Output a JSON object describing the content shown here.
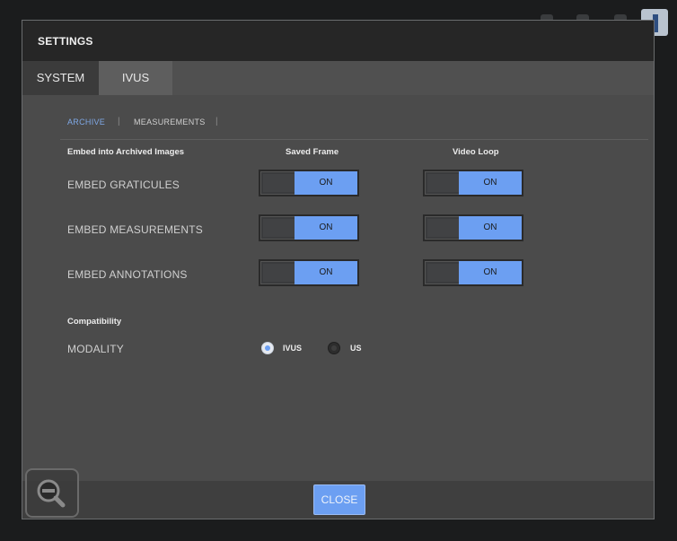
{
  "dialog": {
    "title": "SETTINGS"
  },
  "tabs": [
    {
      "label": "SYSTEM",
      "active": true
    },
    {
      "label": "IVUS",
      "active": false
    }
  ],
  "subtabs": [
    {
      "label": "ARCHIVE",
      "active": true
    },
    {
      "label": "MEASUREMENTS",
      "active": false
    }
  ],
  "archive": {
    "section_title": "Embed into Archived Images",
    "columns": [
      "Saved Frame",
      "Video Loop"
    ],
    "rows": [
      {
        "label": "EMBED GRATICULES",
        "saved_frame": "ON",
        "video_loop": "ON"
      },
      {
        "label": "EMBED MEASUREMENTS",
        "saved_frame": "ON",
        "video_loop": "ON"
      },
      {
        "label": "EMBED ANNOTATIONS",
        "saved_frame": "ON",
        "video_loop": "ON"
      }
    ]
  },
  "compatibility": {
    "section_title": "Compatibility",
    "modality_label": "MODALITY",
    "options": [
      {
        "label": "IVUS",
        "selected": true
      },
      {
        "label": "US",
        "selected": false
      }
    ]
  },
  "footer": {
    "close_label": "CLOSE"
  },
  "icons": {
    "zoom": "zoom-out-icon",
    "logo": "logo-icon"
  },
  "colors": {
    "accent": "#6c9ff2",
    "active_subtab": "#7fa8e6"
  }
}
